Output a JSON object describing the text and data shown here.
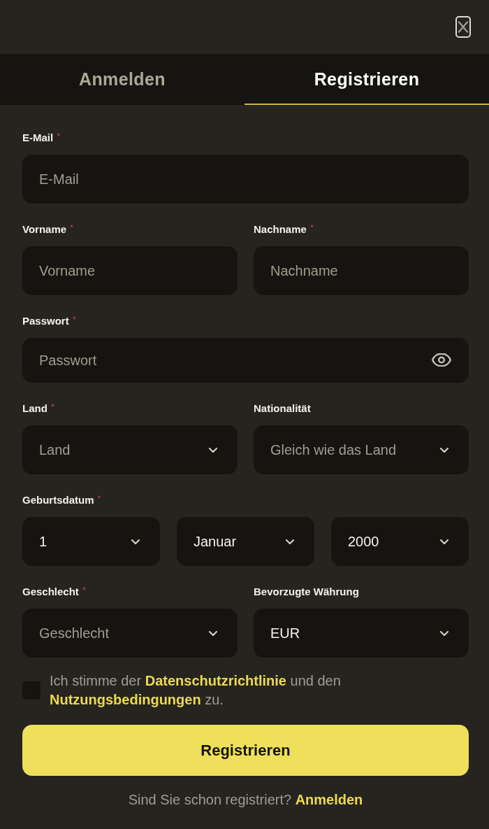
{
  "tabs": [
    {
      "label": "Anmelden",
      "selected": false
    },
    {
      "label": "Registrieren",
      "selected": true
    }
  ],
  "form": {
    "rows": [
      {
        "groups": [
          {
            "label": "E-Mail",
            "required_mark": "*",
            "controls": [
              {
                "kind": "input",
                "placeholder": "E-Mail"
              }
            ]
          }
        ]
      },
      {
        "groups": [
          {
            "label": "Vorname",
            "required_mark": "*",
            "controls": [
              {
                "kind": "input",
                "placeholder": "Vorname"
              }
            ]
          },
          {
            "label": "Nachname",
            "required_mark": "*",
            "controls": [
              {
                "kind": "input",
                "placeholder": "Nachname"
              }
            ]
          }
        ]
      },
      {
        "groups": [
          {
            "label": "Passwort",
            "required_mark": "*",
            "controls": [
              {
                "kind": "password",
                "placeholder": "Passwort"
              }
            ]
          }
        ]
      },
      {
        "groups": [
          {
            "label": "Land",
            "required_mark": "*",
            "controls": [
              {
                "kind": "select",
                "placeholder": "Land"
              }
            ]
          },
          {
            "label": "Nationalität",
            "controls": [
              {
                "kind": "select",
                "placeholder": "Gleich wie das Land"
              }
            ]
          }
        ]
      },
      {
        "groups": [
          {
            "label": "Geburtsdatum",
            "required_mark": "*",
            "controls": [
              {
                "kind": "select",
                "value": "1"
              },
              {
                "kind": "select",
                "value": "Januar"
              },
              {
                "kind": "select",
                "value": "2000"
              }
            ]
          }
        ]
      },
      {
        "groups": [
          {
            "label": "Geschlecht",
            "required_mark": "*",
            "controls": [
              {
                "kind": "select",
                "placeholder": "Geschlecht"
              }
            ]
          },
          {
            "label": "Bevorzugte Währung",
            "controls": [
              {
                "kind": "select",
                "value": "EUR"
              }
            ]
          }
        ]
      }
    ],
    "consent": {
      "checked": false,
      "parts": [
        {
          "kind": "text",
          "text": "Ich stimme der"
        },
        {
          "kind": "link",
          "text": "Datenschutzrichtlinie"
        },
        {
          "kind": "text",
          "text": "und den"
        },
        {
          "kind": "link",
          "text": "Nutzungsbedingungen"
        },
        {
          "kind": "text",
          "text": "zu."
        }
      ]
    },
    "submit": {
      "label": "Registrieren"
    },
    "login_prompt": {
      "text": "Sind Sie schon registriert?",
      "link": "Anmelden"
    }
  }
}
